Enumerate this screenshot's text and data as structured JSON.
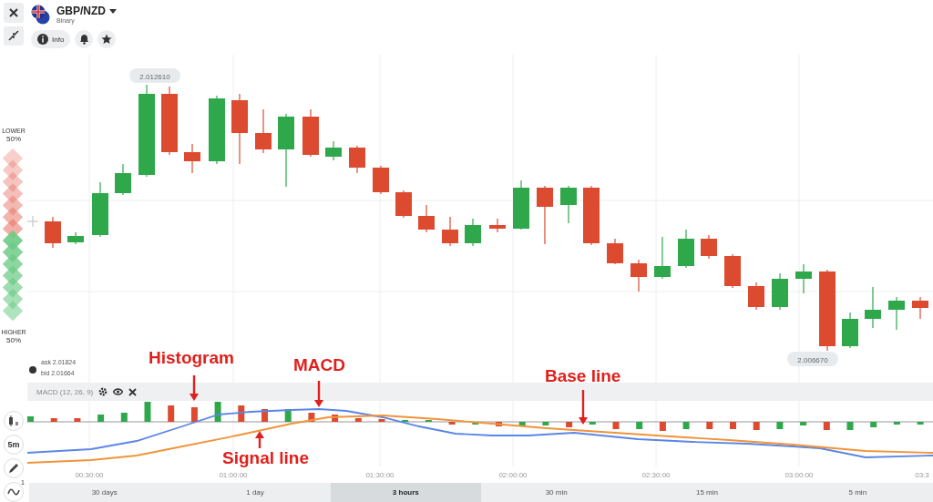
{
  "instrument": {
    "pair": "GBP/NZD",
    "type": "Binary"
  },
  "toolbar": {
    "info_label": "Info"
  },
  "sentiment": {
    "lower_label": "LOWER",
    "lower_value": "50%",
    "higher_label": "HIGHER",
    "higher_value": "50%"
  },
  "price_labels": {
    "high": "2.012610",
    "low": "2.006670"
  },
  "quotes": {
    "ask": "ask 2.01824",
    "bid": "bid 2.01664"
  },
  "indicator": {
    "title": "MACD (12, 26, 9)"
  },
  "time_axis": [
    "00:30:00",
    "01:00:00",
    "01:30:00",
    "02:00:00",
    "02:30:00",
    "03:00:00",
    "03:3"
  ],
  "periods": [
    {
      "label": "30 days",
      "selected": false
    },
    {
      "label": "1 day",
      "selected": false
    },
    {
      "label": "3 hours",
      "selected": true
    },
    {
      "label": "30 min",
      "selected": false
    },
    {
      "label": "15 min",
      "selected": false
    },
    {
      "label": "5 min",
      "selected": false
    }
  ],
  "annotations": [
    {
      "text": "Histogram"
    },
    {
      "text": "MACD"
    },
    {
      "text": "Base line"
    },
    {
      "text": "Signal line"
    }
  ],
  "rail": {
    "interval": "5m",
    "badge": "1"
  }
}
